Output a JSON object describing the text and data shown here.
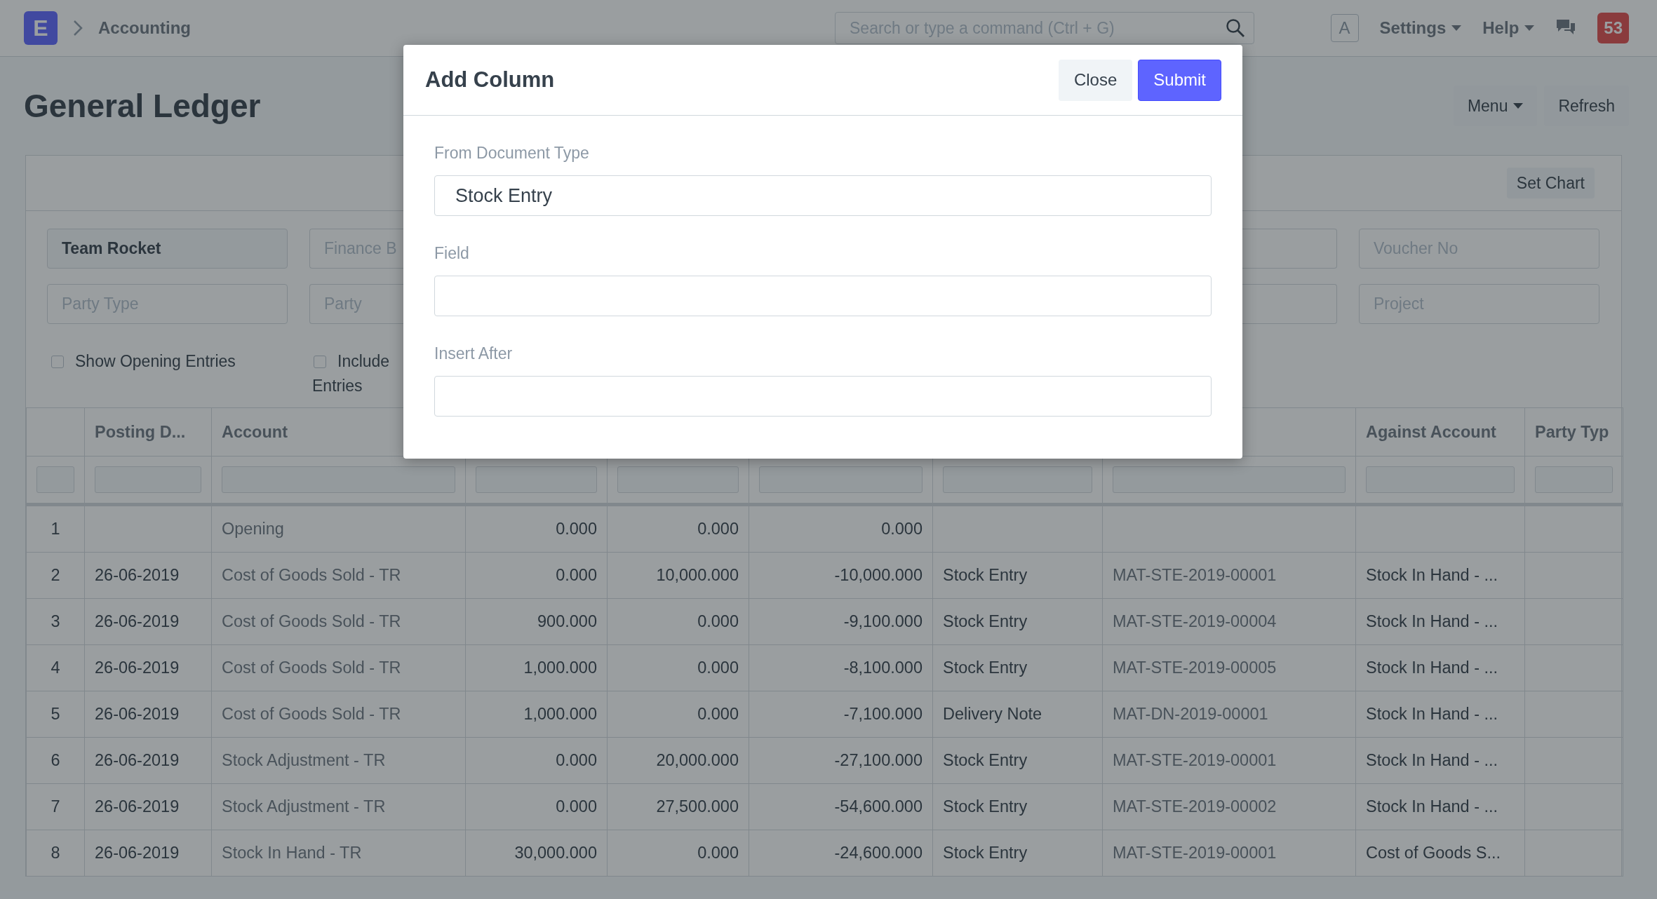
{
  "navbar": {
    "logo": "E",
    "breadcrumb": "Accounting",
    "search": {
      "placeholder": "Search or type a command (Ctrl + G)"
    },
    "avatar": "A",
    "menus": [
      "Settings",
      "Help"
    ],
    "notifications": "53"
  },
  "page": {
    "title": "General Ledger",
    "buttons": [
      {
        "label": "Menu",
        "dropdown": true
      },
      {
        "label": "Refresh",
        "dropdown": false
      }
    ]
  },
  "chart_button": "Set Chart",
  "filters": [
    {
      "value": "Team Rocket"
    },
    {
      "placeholder": "Finance B"
    },
    {
      "placeholder": "Voucher No"
    },
    {
      "placeholder": "Party Type"
    },
    {
      "placeholder": "Party"
    },
    {
      "placeholder": "Project"
    }
  ],
  "checkboxes": [
    {
      "label": "Show Opening Entries",
      "checked": false
    },
    {
      "label": "Include",
      "continuation": "Entries",
      "checked": false
    }
  ],
  "table": {
    "columns": [
      {},
      {
        "label": "Posting D..."
      },
      {
        "label": "Account"
      },
      {},
      {},
      {},
      {},
      {},
      {
        "label": "Against Account"
      },
      {
        "label": "Party Typ"
      }
    ],
    "rows": [
      [
        "1",
        null,
        "Opening",
        "0.000",
        "0.000",
        "0.000",
        null,
        null,
        null,
        null
      ],
      [
        "2",
        "26-06-2019",
        "Cost of Goods Sold - TR",
        "0.000",
        "10,000.000",
        "-10,000.000",
        "Stock Entry",
        "MAT-STE-2019-00001",
        "Stock In Hand - ...",
        null
      ],
      [
        "3",
        "26-06-2019",
        "Cost of Goods Sold - TR",
        "900.000",
        "0.000",
        "-9,100.000",
        "Stock Entry",
        "MAT-STE-2019-00004",
        "Stock In Hand - ...",
        null
      ],
      [
        "4",
        "26-06-2019",
        "Cost of Goods Sold - TR",
        "1,000.000",
        "0.000",
        "-8,100.000",
        "Stock Entry",
        "MAT-STE-2019-00005",
        "Stock In Hand - ...",
        null
      ],
      [
        "5",
        "26-06-2019",
        "Cost of Goods Sold - TR",
        "1,000.000",
        "0.000",
        "-7,100.000",
        "Delivery Note",
        "MAT-DN-2019-00001",
        "Stock In Hand - ...",
        null
      ],
      [
        "6",
        "26-06-2019",
        "Stock Adjustment - TR",
        "0.000",
        "20,000.000",
        "-27,100.000",
        "Stock Entry",
        "MAT-STE-2019-00001",
        "Stock In Hand - ...",
        null
      ],
      [
        "7",
        "26-06-2019",
        "Stock Adjustment - TR",
        "0.000",
        "27,500.000",
        "-54,600.000",
        "Stock Entry",
        "MAT-STE-2019-00002",
        "Stock In Hand - ...",
        null
      ],
      [
        "8",
        "26-06-2019",
        "Stock In Hand - TR",
        "30,000.000",
        "0.000",
        "-24,600.000",
        "Stock Entry",
        "MAT-STE-2019-00001",
        "Cost of Goods S...",
        null
      ]
    ]
  },
  "modal": {
    "title": "Add Column",
    "buttons": [
      {
        "label": "Close",
        "kind": "secondary"
      },
      {
        "label": "Submit",
        "kind": "primary"
      }
    ],
    "fields": [
      {
        "label": "From Document Type",
        "value": "Stock Entry"
      },
      {
        "label": "Field"
      },
      {
        "label": "Insert After"
      }
    ]
  }
}
